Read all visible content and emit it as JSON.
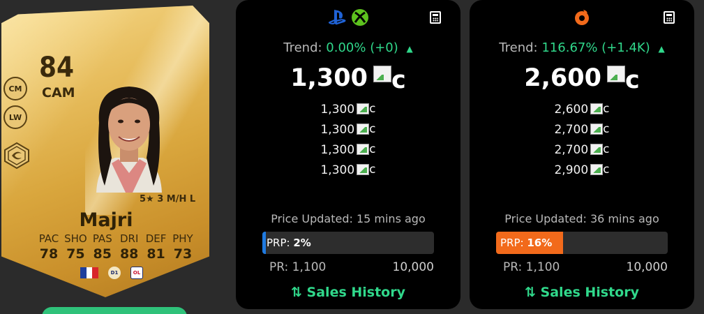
{
  "player": {
    "rating": "84",
    "position": "CAM",
    "alt_positions": [
      "CM",
      "LW"
    ],
    "skills": "5★ 3 M/H L",
    "name": "Majri",
    "stats": [
      {
        "label": "PAC",
        "value": "78"
      },
      {
        "label": "SHO",
        "value": "75"
      },
      {
        "label": "PAS",
        "value": "85"
      },
      {
        "label": "DRI",
        "value": "88"
      },
      {
        "label": "DEF",
        "value": "81"
      },
      {
        "label": "PHY",
        "value": "73"
      }
    ],
    "nation_icon": "france-flag-icon",
    "league_icon": "league-badge-icon",
    "club_icon": "club-badge-icon",
    "league_badge_text": "D1",
    "club_badge_text": "OL"
  },
  "panels": [
    {
      "platform_icons": [
        "playstation-icon",
        "xbox-icon"
      ],
      "trend_label": "Trend:",
      "trend_value": "0.00% (+0)",
      "main_price": "1,300",
      "coin_alt": "c",
      "prices": [
        "1,300",
        "1,300",
        "1,300",
        "1,300"
      ],
      "updated": "Price Updated: 15 mins ago",
      "prp_label": "PRP:",
      "prp_value": "2%",
      "prp_percent": 2,
      "accent_color": "#1f7ae0",
      "pr_label": "PR: 1,100",
      "pr_max": "10,000",
      "sales_label": "Sales History"
    },
    {
      "platform_icons": [
        "origin-icon"
      ],
      "trend_label": "Trend:",
      "trend_value": "116.67% (+1.4K)",
      "main_price": "2,600",
      "coin_alt": "c",
      "prices": [
        "2,600",
        "2,700",
        "2,700",
        "2,900"
      ],
      "updated": "Price Updated: 36 mins ago",
      "prp_label": "PRP:",
      "prp_value": "16%",
      "prp_percent": 16,
      "accent_color": "#f26a1b",
      "pr_label": "PR: 1,100",
      "pr_max": "10,000",
      "sales_label": "Sales History"
    }
  ],
  "colors": {
    "trend_green": "#30d88b",
    "panel_bg": "#000000",
    "card_gold": "#e0b04b"
  }
}
